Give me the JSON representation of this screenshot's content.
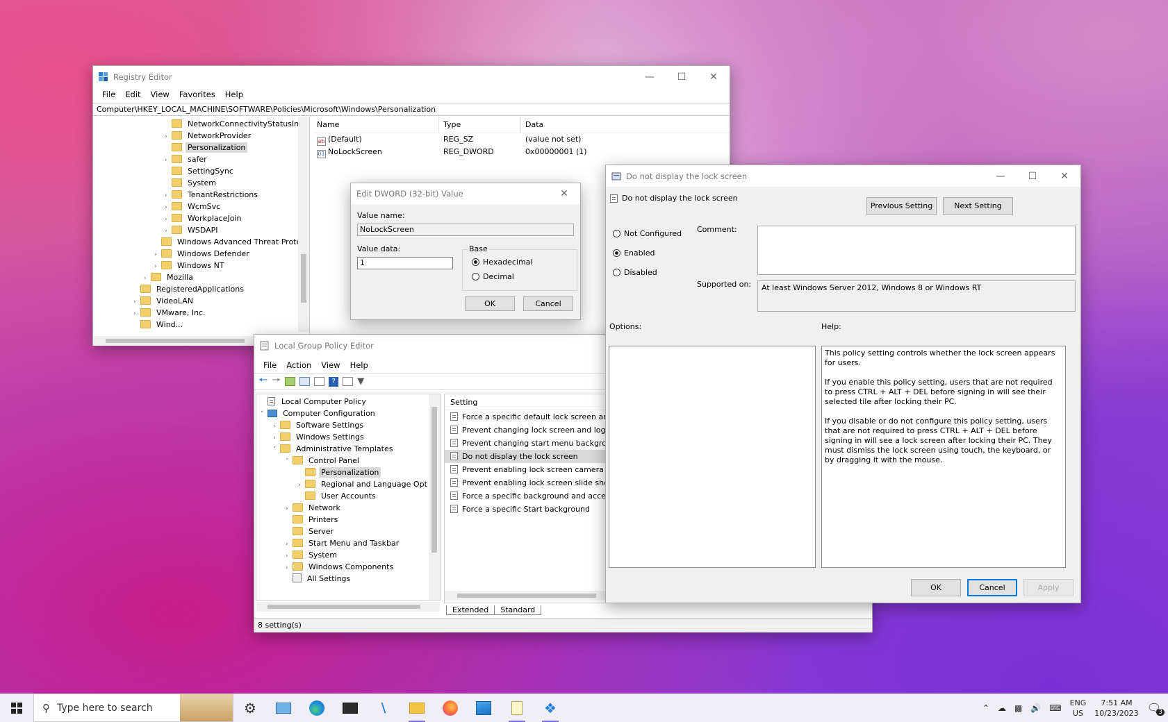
{
  "registry": {
    "title": "Registry Editor",
    "menu": [
      "File",
      "Edit",
      "View",
      "Favorites",
      "Help"
    ],
    "address": "Computer\\HKEY_LOCAL_MACHINE\\SOFTWARE\\Policies\\Microsoft\\Windows\\Personalization",
    "tree": [
      {
        "label": "NetworkConnectivityStatusInc",
        "indent": 3,
        "chev": ""
      },
      {
        "label": "NetworkProvider",
        "indent": 3,
        "chev": ">"
      },
      {
        "label": "Personalization",
        "indent": 3,
        "chev": "",
        "selected": true
      },
      {
        "label": "safer",
        "indent": 3,
        "chev": ">"
      },
      {
        "label": "SettingSync",
        "indent": 3,
        "chev": ""
      },
      {
        "label": "System",
        "indent": 3,
        "chev": ""
      },
      {
        "label": "TenantRestrictions",
        "indent": 3,
        "chev": ">"
      },
      {
        "label": "WcmSvc",
        "indent": 3,
        "chev": ">"
      },
      {
        "label": "WorkplaceJoin",
        "indent": 3,
        "chev": ">"
      },
      {
        "label": "WSDAPI",
        "indent": 3,
        "chev": ">"
      },
      {
        "label": "Windows Advanced Threat Protec",
        "indent": 2,
        "chev": ""
      },
      {
        "label": "Windows Defender",
        "indent": 2,
        "chev": ">"
      },
      {
        "label": "Windows NT",
        "indent": 2,
        "chev": ">"
      },
      {
        "label": "Mozilla",
        "indent": 1,
        "chev": ">"
      },
      {
        "label": "RegisteredApplications",
        "indent": 0,
        "chev": ""
      },
      {
        "label": "VideoLAN",
        "indent": 0,
        "chev": ">"
      },
      {
        "label": "VMware, Inc.",
        "indent": 0,
        "chev": ">"
      },
      {
        "label": "Wind...",
        "indent": 0,
        "chev": ""
      }
    ],
    "columns": [
      "Name",
      "Type",
      "Data"
    ],
    "values": [
      {
        "name": "(Default)",
        "type": "REG_SZ",
        "data": "(value not set)",
        "icon": "string-value-icon"
      },
      {
        "name": "NoLockScreen",
        "type": "REG_DWORD",
        "data": "0x00000001 (1)",
        "icon": "dword-value-icon"
      }
    ]
  },
  "dword": {
    "title": "Edit DWORD (32-bit) Value",
    "value_name_label": "Value name:",
    "value_name": "NoLockScreen",
    "value_data_label": "Value data:",
    "value_data": "1",
    "base_label": "Base",
    "hex": "Hexadecimal",
    "dec": "Decimal",
    "ok": "OK",
    "cancel": "Cancel"
  },
  "gpedit": {
    "title": "Local Group Policy Editor",
    "menu": [
      "File",
      "Action",
      "View",
      "Help"
    ],
    "tree": [
      {
        "label": "Local Computer Policy",
        "indent": 0,
        "chev": "",
        "icon": "policy"
      },
      {
        "label": "Computer Configuration",
        "indent": 0,
        "chev": "v",
        "icon": "computer"
      },
      {
        "label": "Software Settings",
        "indent": 1,
        "chev": ">",
        "icon": "folder"
      },
      {
        "label": "Windows Settings",
        "indent": 1,
        "chev": ">",
        "icon": "folder"
      },
      {
        "label": "Administrative Templates",
        "indent": 1,
        "chev": "v",
        "icon": "folder"
      },
      {
        "label": "Control Panel",
        "indent": 2,
        "chev": "v",
        "icon": "folder"
      },
      {
        "label": "Personalization",
        "indent": 3,
        "chev": "",
        "icon": "folder",
        "selected": true
      },
      {
        "label": "Regional and Language Opt",
        "indent": 3,
        "chev": ">",
        "icon": "folder"
      },
      {
        "label": "User Accounts",
        "indent": 3,
        "chev": "",
        "icon": "folder"
      },
      {
        "label": "Network",
        "indent": 2,
        "chev": ">",
        "icon": "folder"
      },
      {
        "label": "Printers",
        "indent": 2,
        "chev": "",
        "icon": "folder"
      },
      {
        "label": "Server",
        "indent": 2,
        "chev": "",
        "icon": "folder"
      },
      {
        "label": "Start Menu and Taskbar",
        "indent": 2,
        "chev": ">",
        "icon": "folder"
      },
      {
        "label": "System",
        "indent": 2,
        "chev": ">",
        "icon": "folder"
      },
      {
        "label": "Windows Components",
        "indent": 2,
        "chev": ">",
        "icon": "folder"
      },
      {
        "label": "All Settings",
        "indent": 2,
        "chev": "",
        "icon": "settings"
      }
    ],
    "setting_header": "Setting",
    "settings": [
      "Force a specific default lock screen and",
      "Prevent changing lock screen and logon",
      "Prevent changing start menu backgrour",
      "Do not display the lock screen",
      "Prevent enabling lock screen camera",
      "Prevent enabling lock screen slide show",
      "Force a specific background and accent",
      "Force a specific Start background"
    ],
    "tabs": [
      "Extended",
      "Standard"
    ],
    "status": "8 setting(s)"
  },
  "policy": {
    "title": "Do not display the lock screen",
    "heading": "Do not display the lock screen",
    "prev": "Previous Setting",
    "next": "Next Setting",
    "not_configured": "Not Configured",
    "enabled": "Enabled",
    "disabled": "Disabled",
    "comment_label": "Comment:",
    "supported_label": "Supported on:",
    "supported_value": "At least Windows Server 2012, Windows 8 or Windows RT",
    "options_label": "Options:",
    "help_label": "Help:",
    "help_p1": "This policy setting controls whether the lock screen appears for users.",
    "help_p2": "If you enable this policy setting, users that are not required to press CTRL + ALT + DEL before signing in will see their selected tile after locking their PC.",
    "help_p3": "If you disable or do not configure this policy setting, users that are not required to press CTRL + ALT + DEL before signing in will see a lock screen after locking their PC. They must dismiss the lock screen using touch, the keyboard, or by dragging it with the mouse.",
    "ok": "OK",
    "cancel": "Cancel",
    "apply": "Apply"
  },
  "taskbar": {
    "search_placeholder": "Type here to search",
    "lang1": "ENG",
    "lang2": "US",
    "time": "7:51 AM",
    "date": "10/23/2023",
    "notif_count": "3"
  }
}
